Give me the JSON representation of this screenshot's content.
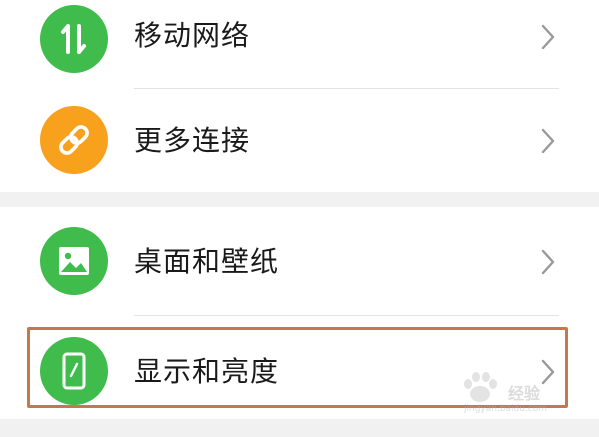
{
  "settings": {
    "items": [
      {
        "label": "移动网络",
        "icon": "mobile-data-icon",
        "color": "#3fbc4b"
      },
      {
        "label": "更多连接",
        "icon": "link-icon",
        "color": "#f8a11d"
      },
      {
        "label": "桌面和壁纸",
        "icon": "image-icon",
        "color": "#3fbc4b"
      },
      {
        "label": "显示和亮度",
        "icon": "phone-display-icon",
        "color": "#3fbc4b"
      }
    ]
  },
  "watermark": {
    "text": "经验",
    "url": "jingyan.baidu.com"
  }
}
